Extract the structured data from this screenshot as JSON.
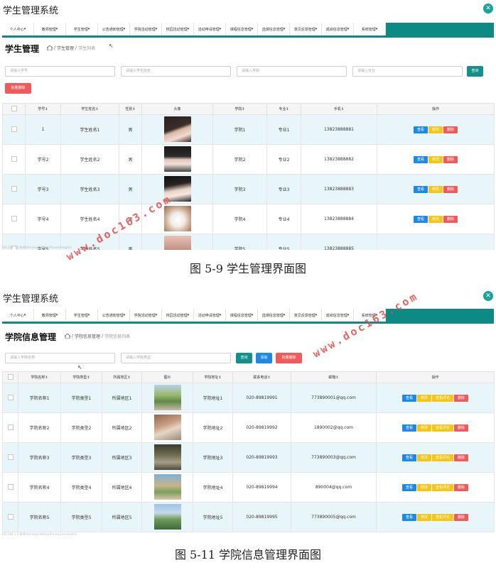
{
  "app_title": "学生管理系统",
  "nav_items": [
    "个人中心",
    "教师管理",
    "学生管理",
    "公告通知管理",
    "学院活动管理",
    "校园活动管理",
    "活动申请管理",
    "课程信息管理",
    "选课信息管理",
    "意见反馈管理",
    "成绩信息管理",
    "系统管理"
  ],
  "screen1": {
    "page_title": "学生管理",
    "breadcrumb": {
      "sep": "/",
      "level1": "学生管理",
      "level2": "学生列表"
    },
    "search": [
      {
        "placeholder": "请输入学号"
      },
      {
        "placeholder": "请输入学生姓名"
      },
      {
        "placeholder": "请输入学院"
      },
      {
        "placeholder": "请输入专业"
      }
    ],
    "query_label": "查询",
    "batch_delete_label": "批量删除",
    "columns": [
      "学号⇕",
      "学生姓名⇕",
      "性别⇕",
      "头像",
      "学院⇕",
      "专业⇕",
      "手机⇕",
      "操作"
    ],
    "rows": [
      {
        "no": "1",
        "name": "学生姓名1",
        "gender": "男",
        "college": "学院1",
        "major": "专业1",
        "phone": "13823888881"
      },
      {
        "no": "学号2",
        "name": "学生姓名2",
        "gender": "男",
        "college": "学院2",
        "major": "专业2",
        "phone": "13823888882"
      },
      {
        "no": "学号3",
        "name": "学生姓名3",
        "gender": "男",
        "college": "学院3",
        "major": "专业3",
        "phone": "13823888883"
      },
      {
        "no": "学号4",
        "name": "学生姓名4",
        "gender": "男",
        "college": "学院4",
        "major": "专业4",
        "phone": "13823888884"
      },
      {
        "no": "学号5",
        "name": "学生姓名5",
        "gender": "男",
        "college": "学院5",
        "major": "专业5",
        "phone": "13823888885"
      }
    ],
    "ops": {
      "view": "查看",
      "edit": "修改",
      "delete": "删除"
    },
    "status_url": "192.168.1.1:8080/ssmxxx/admin/#/xuesheng/list",
    "caption": "图 5-9 学生管理界面图"
  },
  "screen2": {
    "page_title": "学院信息管理",
    "breadcrumb": {
      "sep": "/",
      "level1": "学院信息管理",
      "level2": "学院信息列表"
    },
    "search": [
      {
        "placeholder": "请输入学院名称"
      },
      {
        "placeholder": "请输入学院类型"
      }
    ],
    "query_label": "查询",
    "add_label": "添加",
    "batch_delete_label": "批量删除",
    "columns": [
      "学院名称⇕",
      "学院类型⇕",
      "所属地区⇕",
      "图片",
      "学院地址⇕",
      "联系电话⇕",
      "邮箱⇕",
      "操作"
    ],
    "rows": [
      {
        "name": "学院名称1",
        "type": "学院类型1",
        "region": "所属地区1",
        "address": "学院地址1",
        "phone": "020-89819991",
        "email": "773890001@qq.com"
      },
      {
        "name": "学院名称2",
        "type": "学院类型2",
        "region": "所属地区2",
        "address": "学院地址2",
        "phone": "020-89819992",
        "email": "1890002@qq.com"
      },
      {
        "name": "学院名称3",
        "type": "学院类型3",
        "region": "所属地区3",
        "address": "学院地址3",
        "phone": "020-89819993",
        "email": "773890003@qq.com"
      },
      {
        "name": "学院名称4",
        "type": "学院类型4",
        "region": "所属地区4",
        "address": "学院地址4",
        "phone": "020-89819994",
        "email": "890004@qq.com"
      },
      {
        "name": "学院名称5",
        "type": "学院类型5",
        "region": "所属地区5",
        "address": "学院地址5",
        "phone": "020-89819995",
        "email": "773890005@qq.com"
      }
    ],
    "ops": {
      "view": "查看",
      "edit": "修改",
      "review": "查看评论",
      "delete": "删除"
    },
    "status_url": "192.168.1.1:8080/ssmxxx/admin/#/xueyuanxinxi/list",
    "caption": "图 5-11 学院信息管理界面图"
  },
  "watermark": "www.doc163.com",
  "colors": {
    "teal": "#13908a",
    "blue": "#1e88e5",
    "red": "#ef5a5a",
    "yellow": "#f5c518",
    "row_alt": "#e8f6f9"
  }
}
